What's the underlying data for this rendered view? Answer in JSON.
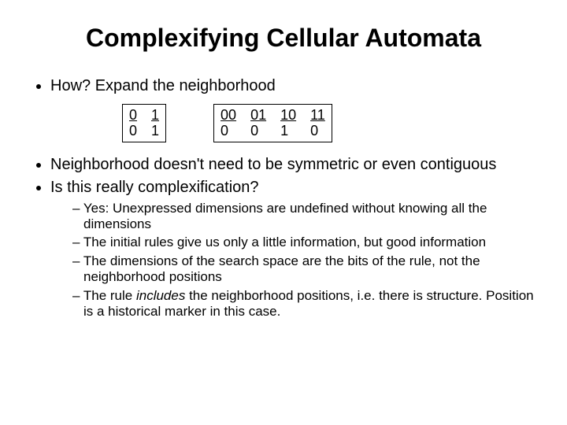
{
  "title": "Complexifying Cellular Automata",
  "bullets": {
    "b1": "How? Expand the neighborhood",
    "b2": "Neighborhood doesn't need to be symmetric or even contiguous",
    "b3": "Is this really complexification?",
    "sub": {
      "s1": "Yes: Unexpressed dimensions are undefined without knowing all the dimensions",
      "s2": "The initial rules give us only a little information, but good information",
      "s3": "The dimensions of the search space are the bits of the rule, not the neighborhood positions",
      "s4a": "The rule ",
      "s4b": "includes",
      "s4c": " the neighborhood positions, i.e. there is structure.  Position is a historical marker in this case."
    }
  },
  "table1": {
    "c0t": "0",
    "c0b": "0",
    "c1t": "1",
    "c1b": "1"
  },
  "table2": {
    "c0t": "00",
    "c0b": "0",
    "c1t": "01",
    "c1b": "0",
    "c2t": "10",
    "c2b": "1",
    "c3t": "11",
    "c3b": "0"
  }
}
